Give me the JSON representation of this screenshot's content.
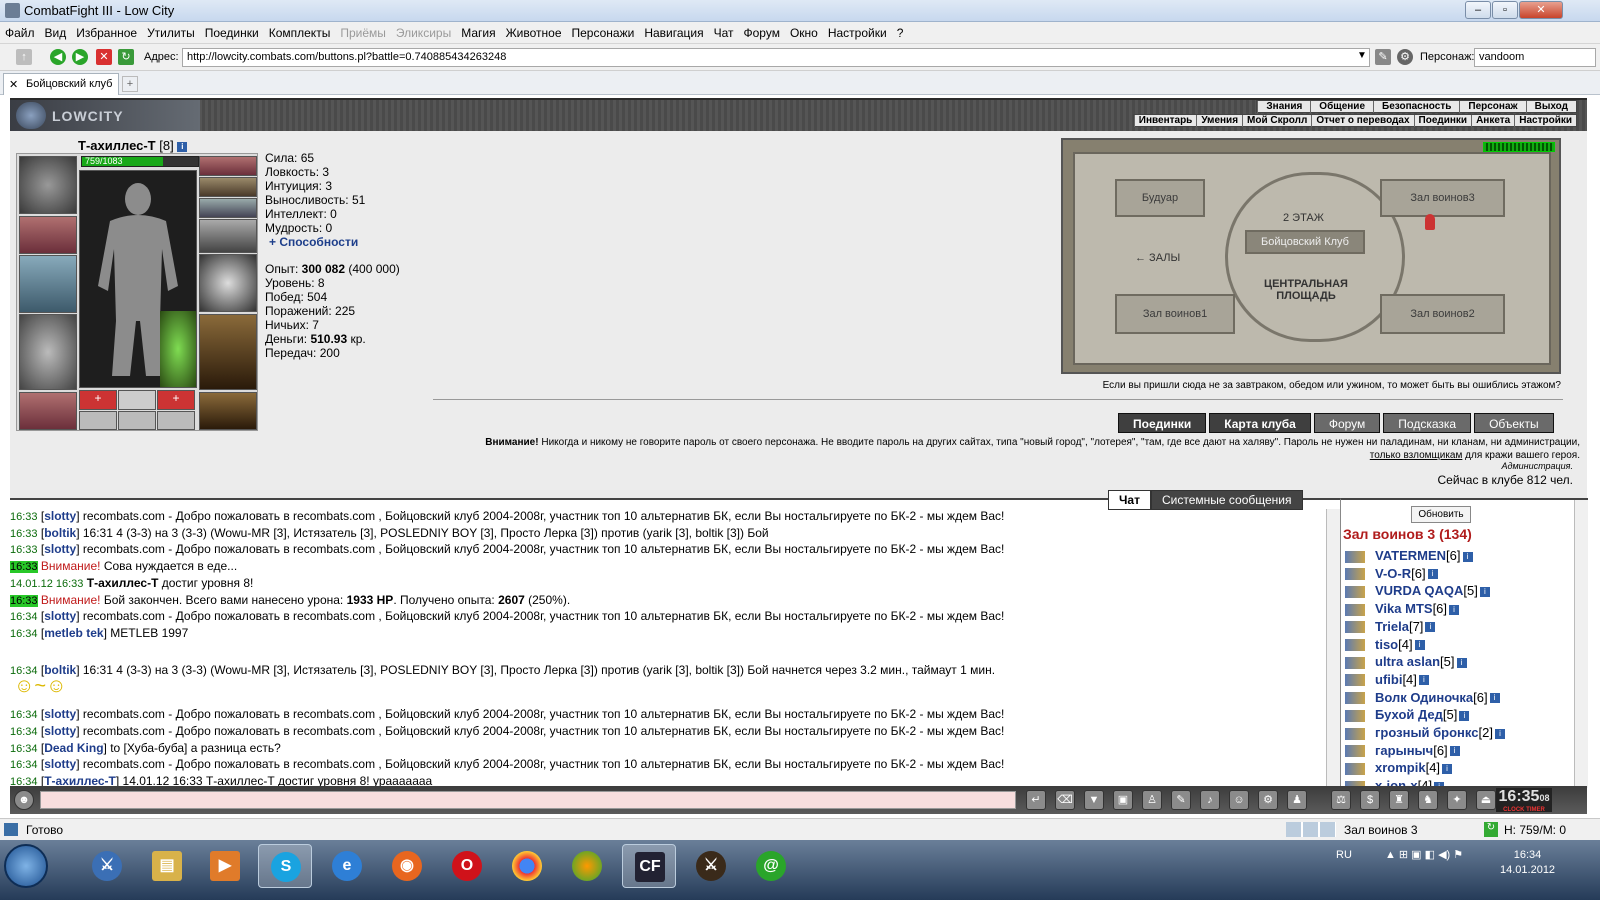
{
  "window": {
    "title": "CombatFight III - Low City"
  },
  "menu": [
    "Файл",
    "Вид",
    "Избранное",
    "Утилиты",
    "Поединки",
    "Комплекты",
    "Приёмы",
    "Эликсиры",
    "Магия",
    "Животное",
    "Персонажи",
    "Навигация",
    "Чат",
    "Форум",
    "Окно",
    "Настройки",
    "?"
  ],
  "menu_disabled": [
    "Приёмы",
    "Эликсиры"
  ],
  "address": {
    "label": "Адрес:",
    "url": "http://lowcity.combats.com/buttons.pl?battle=0.740885434263248",
    "char_label": "Персонаж:",
    "char_value": "vandoom"
  },
  "tab": {
    "label": "Бойцовский клуб"
  },
  "game": {
    "logo": "LOWCITY",
    "nav_top": [
      "Знания",
      "Общение",
      "Безопасность",
      "Персонаж",
      "Выход"
    ],
    "nav_bottom": [
      "Инвентарь",
      "Умения",
      "Мой Скролл",
      "Отчет о переводах",
      "Поединки",
      "Анкета",
      "Настройки"
    ]
  },
  "character": {
    "name": "Т-ахиллес-Т",
    "level": "[8]",
    "hp": "759/1083",
    "hp_fraction": 0.7
  },
  "stats": [
    "Сила: 65",
    "Ловкость: 3",
    "Интуиция: 3",
    "Выносливость: 51",
    "Интеллект: 0",
    "Мудрость: 0"
  ],
  "abilities_link": "+ Способности",
  "stats2": {
    "exp_label": "Опыт:",
    "exp_value": "300 082",
    "exp_next": "(400 000)",
    "level": "Уровень: 8",
    "wins": "Побед: 504",
    "losses": "Поражений: 225",
    "draws": "Ничьих: 7",
    "money_label": "Деньги:",
    "money_value": "510.93",
    "money_unit": "кр.",
    "transfers": "Передач: 200"
  },
  "map": {
    "rooms": {
      "boudoir": "Будуар",
      "hall3": "Зал воинов3",
      "hall1": "Зал воинов1",
      "hall2": "Зал воинов2"
    },
    "floor": "2 ЭТАЖ",
    "club": "Бойцовский Клуб",
    "halls": "← ЗАЛЫ",
    "square": "ЦЕНТРАЛЬНАЯ ПЛОЩАДЬ",
    "caption": "Если вы пришли сюда не за завтраком, обедом или ужином, то может быть вы ошиблись этажом?"
  },
  "buttons": [
    "Поединки",
    "Карта клуба",
    "Форум",
    "Подсказка",
    "Объекты"
  ],
  "warning": {
    "bold": "Внимание!",
    "text": "Никогда и никому не говорите пароль от своего персонажа. Не вводите пароль на других сайтах, типа \"новый город\", \"лотерея\", \"там, где все дают на халяву\". Пароль не нужен ни паладинам, ни кланам, ни администрации,",
    "link": "только взломщикам",
    "tail": "для кражи вашего героя.",
    "admin": "Администрация."
  },
  "online": "Сейчас в клубе 812 чел.",
  "chat_tabs": [
    "Чат",
    "Системные сообщения"
  ],
  "chat": [
    {
      "t": "16:33",
      "n": "slotty",
      "m": "recombats.com - Добро пожаловать в recombats.com , Бойцовский клуб 2004-2008г, участник топ 10 альтернатив БК, если Вы ностальгируете по БК-2 - мы ждем Вас!"
    },
    {
      "t": "16:33",
      "n": "boltik",
      "m": "16:31 4 (3-3) на 3 (3-3) (Wowu-MR [3], Истязатель [3], POSLEDNIY BOY [3], Просто Лерка [3]) против (yarik [3], boltik [3]) Бой"
    },
    {
      "t": "16:33",
      "n": "slotty",
      "m": "recombats.com - Добро пожаловать в recombats.com , Бойцовский клуб 2004-2008г, участник топ 10 альтернатив БК, если Вы ностальгируете по БК-2 - мы ждем Вас!"
    },
    {
      "t": "16:33",
      "a": "Внимание!",
      "m": "Сова нуждается в еде..."
    },
    {
      "t": "14.01.12 16:33",
      "b": "Т-ахиллес-Т",
      "m": "достиг уровня 8!"
    },
    {
      "t": "16:33",
      "a": "Внимание!",
      "m": "Бой закончен. Всего вами нанесено урона:",
      "b1": "1933 HP",
      "m2": ". Получено опыта:",
      "b2": "2607",
      "m3": "(250%)."
    },
    {
      "t": "16:34",
      "n": "slotty",
      "m": "recombats.com - Добро пожаловать в recombats.com , Бойцовский клуб 2004-2008г, участник топ 10 альтернатив БК, если Вы ностальгируете по БК-2 - мы ждем Вас!"
    },
    {
      "t": "16:34",
      "n": "metleb tek",
      "m": "METLEB 1997"
    },
    {
      "t": "16:34",
      "n": "boltik",
      "m": "16:31 4 (3-3) на 3 (3-3) (Wowu-MR [3], Истязатель [3], POSLEDNIY BOY [3], Просто Лерка [3]) против (yarik [3], boltik [3]) Бой начнется через 3.2 мин., таймаут 1 мин."
    },
    {
      "t": "16:34",
      "n": "slotty",
      "m": "recombats.com - Добро пожаловать в recombats.com , Бойцовский клуб 2004-2008г, участник топ 10 альтернатив БК, если Вы ностальгируете по БК-2 - мы ждем Вас!"
    },
    {
      "t": "16:34",
      "n": "slotty",
      "m": "recombats.com - Добро пожаловать в recombats.com , Бойцовский клуб 2004-2008г, участник топ 10 альтернатив БК, если Вы ностальгируете по БК-2 - мы ждем Вас!"
    },
    {
      "t": "16:34",
      "n": "Dead King",
      "m": "to [Хуба-буба] а разница есть?"
    },
    {
      "t": "16:34",
      "n": "slotty",
      "m": "recombats.com - Добро пожаловать в recombats.com , Бойцовский клуб 2004-2008г, участник топ 10 альтернатив БК, если Вы ностальгируете по БК-2 - мы ждем Вас!"
    },
    {
      "t": "16:34",
      "n": "Т-ахиллес-Т",
      "m": "14.01.12 16:33 Т-ахиллес-Т достиг уровня 8! урааааааа"
    }
  ],
  "userlist": {
    "refresh": "Обновить",
    "room": "Зал воинов 3 (134)",
    "users": [
      {
        "n": "VATERMEN",
        "l": "[6]"
      },
      {
        "n": "V-O-R",
        "l": "[6]"
      },
      {
        "n": "VURDA QAQA",
        "l": "[5]"
      },
      {
        "n": "Vika MTS",
        "l": "[6]"
      },
      {
        "n": "Triela",
        "l": "[7]"
      },
      {
        "n": "tiso",
        "l": "[4]"
      },
      {
        "n": "ultra aslan",
        "l": "[5]"
      },
      {
        "n": "ufibi",
        "l": "[4]"
      },
      {
        "n": "Волк Одиночка",
        "l": "[6]"
      },
      {
        "n": "Бухой Дед",
        "l": "[5]"
      },
      {
        "n": "грозный бронкс",
        "l": "[2]"
      },
      {
        "n": "гарыныч",
        "l": "[6]"
      },
      {
        "n": "xrompik",
        "l": "[4]"
      },
      {
        "n": "x-ion-x",
        "l": "[4]"
      }
    ]
  },
  "clock": {
    "time": "16:35",
    "sec": "08",
    "label": "CLOCK TIMER"
  },
  "status": {
    "left": "Готово",
    "room": "Зал воинов 3",
    "hp": "H: 759/M: 0"
  },
  "taskbar": {
    "lang": "RU",
    "time": "16:34",
    "date": "14.01.2012"
  }
}
